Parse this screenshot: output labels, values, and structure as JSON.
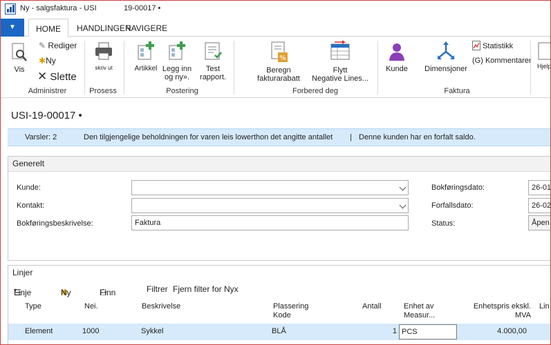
{
  "window": {
    "title": "Ny - salgsfaktura - USI",
    "title_number": "19-00017 •"
  },
  "ribbon_tabs": {
    "menu_icon": "▼",
    "home": "HOME",
    "actions": "HANDLINGER",
    "navigate": "NAVIGERE"
  },
  "ribbon": {
    "manage": {
      "view": "Vis",
      "edit": "Rediger",
      "new": "Ny",
      "delete": "Slette",
      "label": "Administrer"
    },
    "process": {
      "print": "skriv ut",
      "label": "Prosess"
    },
    "posting": {
      "item": "Artikkel",
      "insert": "Legg inn og ny».",
      "test": "Test rapport.",
      "label": "Postering"
    },
    "prepare": {
      "discount": "Beregn fakturarabatt",
      "move_line1": "Flytt",
      "move_line2": "Negative  Lines...",
      "label": "Forbered deg"
    },
    "invoice": {
      "customer": "Kunde",
      "dimensions": "Dimensjoner",
      "statistics": "Statistikk",
      "comments": "(G) Kommentarer",
      "help": "Hjelp",
      "label": "Faktura"
    }
  },
  "page": {
    "title": "USI-19-00017 •"
  },
  "notifications": {
    "count": "Varsler: 2",
    "msg1": "Den tilgjengelige beholdningen for varen leis lowerthon det angitte antallet",
    "separator": "|",
    "msg2": "Denne kunden har en forfalt saldo."
  },
  "general": {
    "header": "Generelt",
    "customer_label": "Kunde:",
    "customer_value": "",
    "contact_label": "Kontakt:",
    "contact_value": "",
    "description_label": "Bokføringsbeskrivelse:",
    "description_value": "Faktura",
    "posting_date_label": "Bokføringsdato:",
    "posting_date_value": "26-01",
    "due_date_label": "Forfallsdato:",
    "due_date_value": "26-02",
    "status_label": "Status:",
    "status_value": "Åpen"
  },
  "lines": {
    "header": "Linjer",
    "toolbar": {
      "line": "Linje",
      "new": "Ny",
      "find": "Finn",
      "filter": "Filtrer",
      "clear_filter": "Fjern filter for Nyx"
    },
    "columns": {
      "type": "Type",
      "no": "Nei.",
      "description": "Beskrivelse",
      "location": "Plassering Kode",
      "quantity": "Antall",
      "unit": "Enhet av Measur...",
      "unit_price": "Enhetspris ekskl. MVA",
      "line": "Lin"
    },
    "rows": [
      {
        "type": "Element",
        "no": "1000",
        "description": "Sykkel",
        "location": "BLÅ",
        "quantity": "1",
        "unit": "PCS",
        "unit_price": "4.000,00"
      }
    ]
  }
}
